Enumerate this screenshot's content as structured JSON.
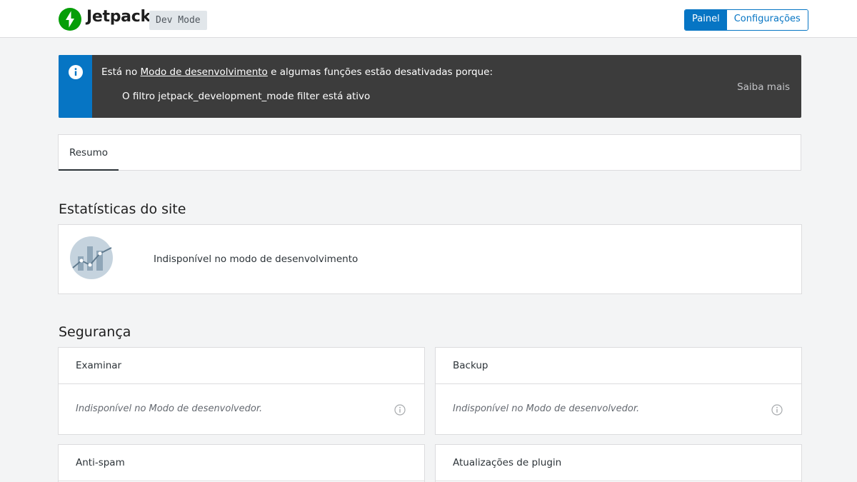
{
  "header": {
    "brand": "Jetpack",
    "badge": "Dev Mode",
    "nav": [
      {
        "label": "Painel",
        "active": true
      },
      {
        "label": "Configurações",
        "active": false
      }
    ]
  },
  "notice": {
    "prefix": "Está no ",
    "link": "Modo de desenvolvimento",
    "suffix": " e algumas funções estão desativadas porque:",
    "reason": "O filtro jetpack_development_mode filter está ativo",
    "action": "Saiba mais",
    "icon": "info-icon"
  },
  "tabs": [
    {
      "label": "Resumo",
      "active": true
    }
  ],
  "stats": {
    "title": "Estatísticas do site",
    "message": "Indisponível no modo de desenvolvimento",
    "illustration": "chart-illustration-icon"
  },
  "security": {
    "title": "Segurança",
    "cards": [
      {
        "title": "Examinar",
        "message": "Indisponível no Modo de desenvolvedor."
      },
      {
        "title": "Backup",
        "message": "Indisponível no Modo de desenvolvedor."
      },
      {
        "title": "Anti-spam",
        "message": ""
      },
      {
        "title": "Atualizações de plugin",
        "message": ""
      }
    ]
  },
  "colors": {
    "accent": "#0675c4",
    "jetpack_green": "#069e08",
    "notice_bg": "#3c3c3c",
    "page_bg": "#f3f4f5"
  }
}
